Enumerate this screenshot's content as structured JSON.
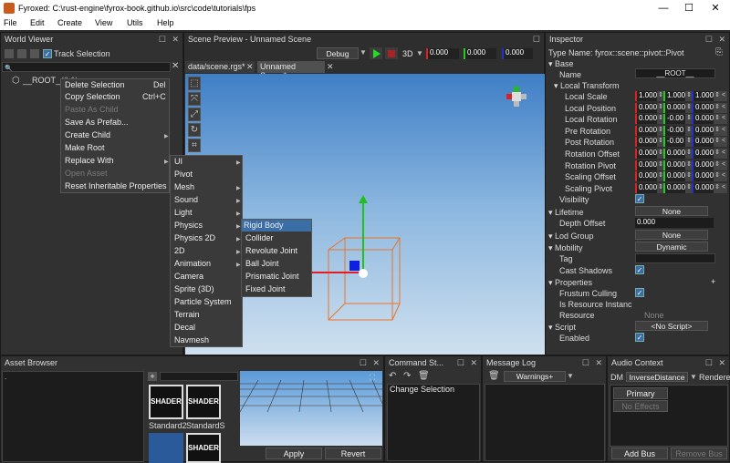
{
  "window": {
    "title": "Fyroxed: C:\\rust-engine\\fyrox-book.github.io\\src\\code\\tutorials\\fps",
    "minimize": "—",
    "maximize": "☐",
    "close": "✕"
  },
  "menu": {
    "file": "File",
    "edit": "Edit",
    "create": "Create",
    "view": "View",
    "utils": "Utils",
    "help": "Help"
  },
  "world_viewer": {
    "title": "World Viewer",
    "track_selection": "Track Selection",
    "root": "__ROOT__",
    "root_suffix": "(0:1)"
  },
  "context_menu": {
    "items": [
      "Delete Selection",
      "Copy Selection",
      "Paste As Child",
      "Save As Prefab...",
      "Create Child",
      "Make Root",
      "Replace With",
      "Open Asset",
      "Reset Inheritable Properties"
    ],
    "shortcuts": {
      "delete": "Del",
      "copy": "Ctrl+C"
    }
  },
  "replace_menu": {
    "items": [
      "UI",
      "Pivot",
      "Mesh",
      "Sound",
      "Light",
      "Physics",
      "Physics 2D",
      "2D",
      "Animation",
      "Camera",
      "Sprite (3D)",
      "Particle System",
      "Terrain",
      "Decal",
      "Navmesh"
    ]
  },
  "physics_menu": {
    "items": [
      "Rigid Body",
      "Collider",
      "Revolute Joint",
      "Ball Joint",
      "Prismatic Joint",
      "Fixed Joint"
    ]
  },
  "scene_preview": {
    "title": "Scene Preview - Unnamed Scene",
    "debug": "Debug",
    "mode_3d": "3D",
    "v1": "0.000",
    "v2": "0.000",
    "v3": "0.000",
    "tab1": "data/scene.rgs*",
    "tab2": "Unnamed Scene*"
  },
  "inspector": {
    "title": "Inspector",
    "type_name": "Type Name: fyrox::scene::pivot::Pivot",
    "base": "Base",
    "name_label": "Name",
    "name_value": "__ROOT__",
    "local_transform": "Local Transform",
    "rows": [
      {
        "label": "Local Scale",
        "x": "1.000",
        "y": "1.000",
        "z": "1.000"
      },
      {
        "label": "Local Position",
        "x": "0.000",
        "y": "0.000",
        "z": "0.000"
      },
      {
        "label": "Local Rotation",
        "x": "0.000",
        "y": "-0.00",
        "z": "0.000"
      },
      {
        "label": "Pre Rotation",
        "x": "0.000",
        "y": "-0.00",
        "z": "0.000"
      },
      {
        "label": "Post Rotation",
        "x": "0.000",
        "y": "-0.00",
        "z": "0.000"
      },
      {
        "label": "Rotation Offset",
        "x": "0.000",
        "y": "0.000",
        "z": "0.000"
      },
      {
        "label": "Rotation Pivot",
        "x": "0.000",
        "y": "0.000",
        "z": "0.000"
      },
      {
        "label": "Scaling Offset",
        "x": "0.000",
        "y": "0.000",
        "z": "0.000"
      },
      {
        "label": "Scaling Pivot",
        "x": "0.000",
        "y": "0.000",
        "z": "0.000"
      }
    ],
    "visibility": "Visibility",
    "lifetime": "Lifetime",
    "lifetime_value": "None",
    "depth_offset": "Depth Offset",
    "depth_value": "0.000",
    "lod_group": "Lod Group",
    "lod_value": "None",
    "mobility": "Mobility",
    "mobility_value": "Dynamic",
    "tag": "Tag",
    "cast_shadows": "Cast Shadows",
    "properties": "Properties",
    "frustum_culling": "Frustum Culling",
    "is_resource_instance": "Is Resource Instanc",
    "resource": "Resource",
    "resource_value": "None",
    "script": "Script",
    "script_value": "<No Script>",
    "enabled": "Enabled"
  },
  "asset_browser": {
    "title": "Asset Browser",
    "path": ".",
    "thumb_label": "SHADER",
    "asset1": "Standard2",
    "asset2": "StandardS",
    "apply": "Apply",
    "revert": "Revert"
  },
  "command_stack": {
    "title": "Command St...",
    "entry": "Change Selection"
  },
  "message_log": {
    "title": "Message Log",
    "filter": "Warnings+"
  },
  "audio_context": {
    "title": "Audio Context",
    "dm_label": "DM",
    "dm_value": "InverseDistance",
    "renderer": "Rendere",
    "primary": "Primary",
    "no_effects": "No Effects",
    "add_bus": "Add Bus",
    "remove_bus": "Remove Bus"
  },
  "colors": {
    "accent": "#3a6ea5",
    "x_axis": "#e02020",
    "y_axis": "#20c020",
    "z_axis": "#2030d0",
    "bbox": "#e8742a"
  }
}
